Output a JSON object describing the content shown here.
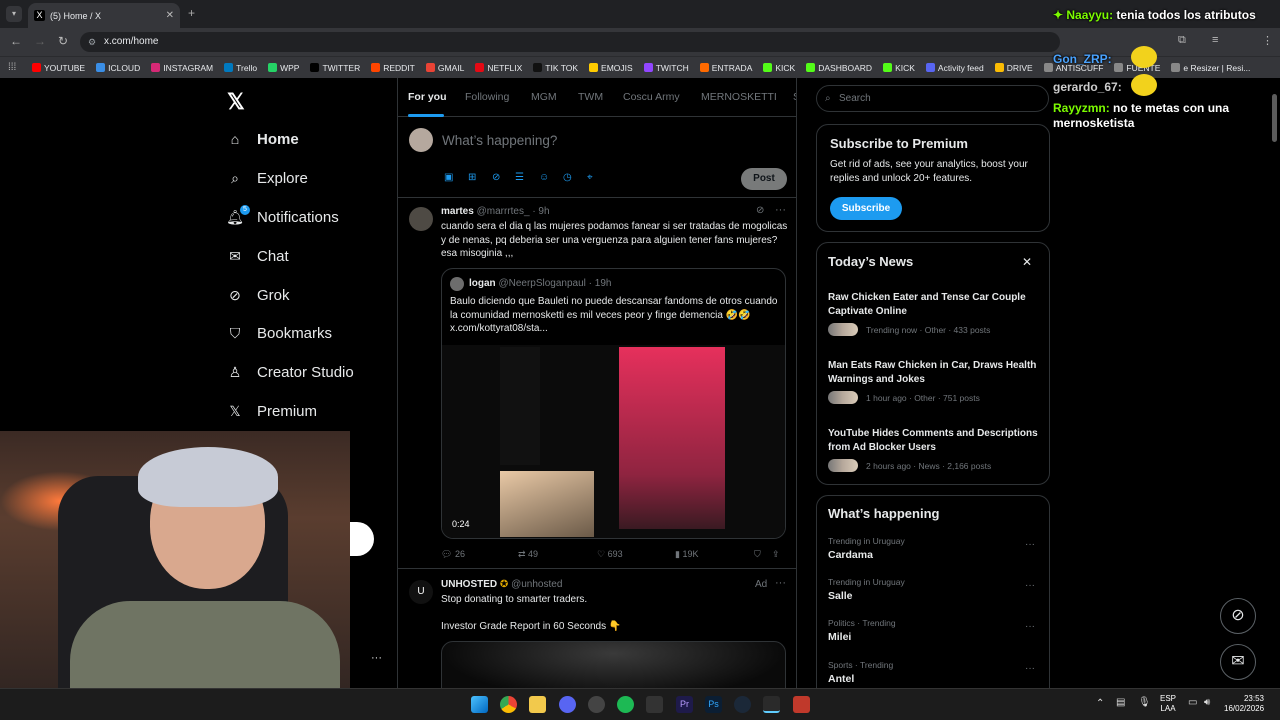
{
  "browser": {
    "tab_title": "(5) Home / X",
    "tab_favicon": "X",
    "url": "x.com/home",
    "bookmarks": [
      {
        "label": "YOUTUBE",
        "color": "#ff0000"
      },
      {
        "label": "ICLOUD",
        "color": "#3a8ee6"
      },
      {
        "label": "INSTAGRAM",
        "color": "#d62976"
      },
      {
        "label": "Trello",
        "color": "#0079bf"
      },
      {
        "label": "WPP",
        "color": "#25d366"
      },
      {
        "label": "TWITTER",
        "color": "#000000"
      },
      {
        "label": "REDDIT",
        "color": "#ff4500"
      },
      {
        "label": "GMAIL",
        "color": "#ea4335"
      },
      {
        "label": "NETFLIX",
        "color": "#e50914"
      },
      {
        "label": "TIK TOK",
        "color": "#111111"
      },
      {
        "label": "EMOJIS",
        "color": "#ffcc00"
      },
      {
        "label": "TWITCH",
        "color": "#9146ff"
      },
      {
        "label": "ENTRADA",
        "color": "#ff6a00"
      },
      {
        "label": "KICK",
        "color": "#53fc18"
      },
      {
        "label": "DASHBOARD",
        "color": "#53fc18"
      },
      {
        "label": "KICK",
        "color": "#53fc18"
      },
      {
        "label": "Activity feed",
        "color": "#5865f2"
      },
      {
        "label": "DRIVE",
        "color": "#fbbc04"
      },
      {
        "label": "ANTISCUFF",
        "color": "#888888"
      },
      {
        "label": "FUENTE",
        "color": "#888888"
      },
      {
        "label": "e Resizer | Resi...",
        "color": "#888888"
      }
    ]
  },
  "nav": {
    "items": [
      {
        "label": "Home",
        "icon": "home-icon",
        "glyph": "⌂"
      },
      {
        "label": "Explore",
        "icon": "search-icon",
        "glyph": "⌕"
      },
      {
        "label": "Notifications",
        "icon": "bell-icon",
        "glyph": "🔔︎"
      },
      {
        "label": "Chat",
        "icon": "mail-icon",
        "glyph": "✉"
      },
      {
        "label": "Grok",
        "icon": "grok-icon",
        "glyph": "⊘"
      },
      {
        "label": "Bookmarks",
        "icon": "bookmark-icon",
        "glyph": "⛉"
      },
      {
        "label": "Creator Studio",
        "icon": "creator-icon",
        "glyph": "♙"
      },
      {
        "label": "Premium",
        "icon": "x-premium-icon",
        "glyph": "𝕏"
      }
    ],
    "notifications_badge": "5"
  },
  "feed": {
    "tabs": [
      "For you",
      "Following",
      "MGM",
      "TWM",
      "Coscu Army",
      "MERNOSKETTI",
      "S"
    ],
    "composer_placeholder": "What’s happening?",
    "post_button": "Post",
    "tweet1": {
      "name": "martes",
      "handle": "@marrrtes_",
      "time": "· 9h",
      "text": "cuando sera el dia q las mujeres podamos fanear si ser tratadas de mogolicas y de nenas, pq deberia ser una verguenza para alguien tener fans mujeres? esa misoginia ,,,",
      "quote": {
        "name": "logan",
        "handle": "@NeerpSloganpaul",
        "time": "· 19h",
        "text": "Baulo diciendo que Bauleti no puede descansar fandoms de otros cuando la comunidad mernosketti es mil veces peor y finge demencia 🤣🤣 x.com/kottyrat08/sta...",
        "video_time": "0:24"
      },
      "replies": "26",
      "reposts": "49",
      "likes": "693",
      "views": "19K"
    },
    "tweet2": {
      "name": "UNHOSTED",
      "handle": "@unhosted",
      "ad": "Ad",
      "line1": "Stop donating to smarter traders.",
      "line2": "Investor Grade Report in 60 Seconds 👇"
    }
  },
  "sidebar": {
    "search_placeholder": "Search",
    "premium": {
      "title": "Subscribe to Premium",
      "body": "Get rid of ads, see your analytics, boost your replies and unlock 20+ features.",
      "button": "Subscribe"
    },
    "news": {
      "title": "Today’s News",
      "items": [
        {
          "headline": "Raw Chicken Eater and Tense Car Couple Captivate Online",
          "meta": "Trending now · Other · 433 posts"
        },
        {
          "headline": "Man Eats Raw Chicken in Car, Draws Health Warnings and Jokes",
          "meta": "1 hour ago · Other · 751 posts"
        },
        {
          "headline": "YouTube Hides Comments and Descriptions from Ad Blocker Users",
          "meta": "2 hours ago · News · 2,166 posts"
        }
      ]
    },
    "happening": {
      "title": "What’s happening",
      "items": [
        {
          "context": "Trending in Uruguay",
          "topic": "Cardama"
        },
        {
          "context": "Trending in Uruguay",
          "topic": "Salle"
        },
        {
          "context": "Politics · Trending",
          "topic": "Milei"
        },
        {
          "context": "Sports · Trending",
          "topic": "Antel"
        }
      ]
    }
  },
  "chat_overlay": [
    {
      "user": "✦ Naayyu:",
      "msg": "tenia todos los atributos",
      "color": "#7cfc00"
    },
    {
      "user": "Gon_ZRP:",
      "msg": "",
      "color": "#4aa3ff"
    },
    {
      "user": "gerardo_67:",
      "msg": "",
      "color": "#cccccc"
    },
    {
      "user": "Rayyzmn:",
      "msg": "no te metas con una mernosketista",
      "color": "#7cfc00"
    }
  ],
  "taskbar": {
    "lang": "ESP",
    "lang2": "LAA",
    "time": "23:53",
    "date": "16/02/2026"
  }
}
